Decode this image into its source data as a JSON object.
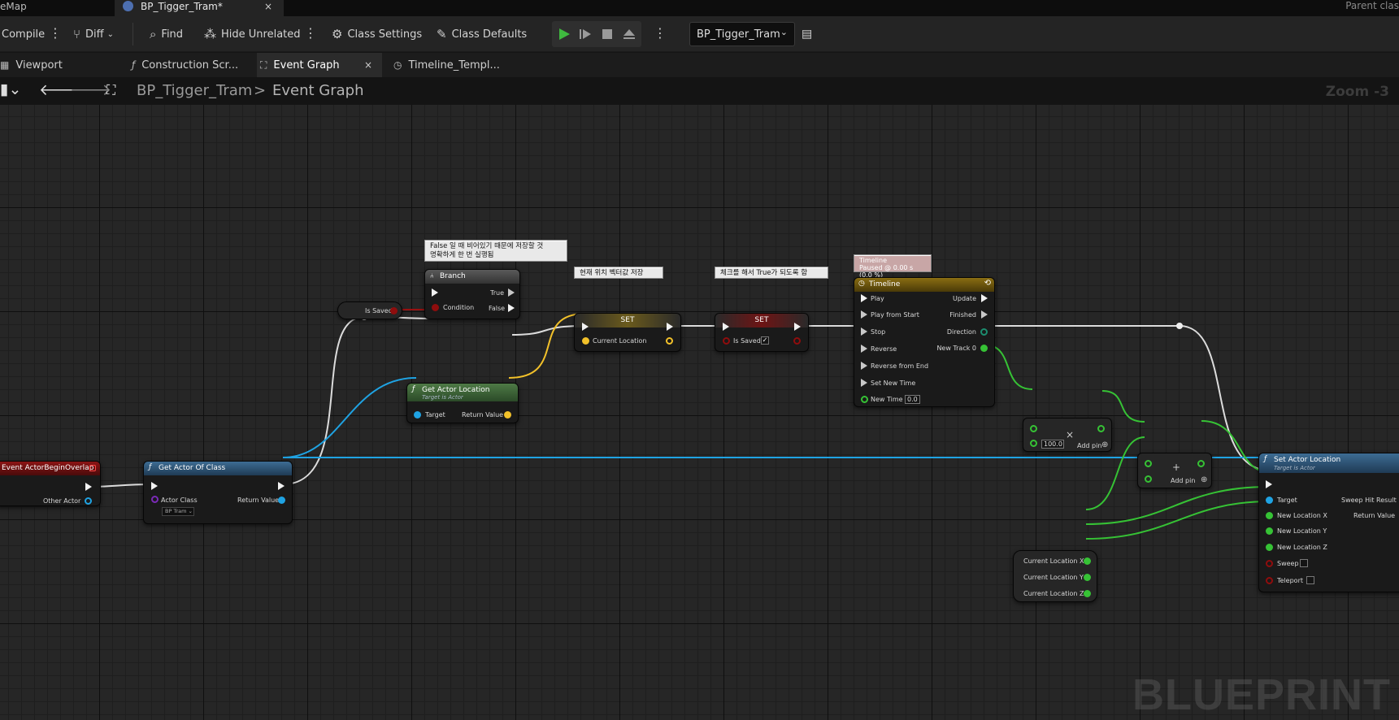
{
  "tabs": {
    "map_tab_label": "eMap",
    "blueprint_tab_label": "BP_Tigger_Tram*",
    "close_glyph": "×",
    "parent_class_label": "Parent clas"
  },
  "toolbar": {
    "compile_label": "Compile",
    "diff_label": "Diff",
    "find_label": "Find",
    "hide_unrelated_label": "Hide Unrelated",
    "class_settings_label": "Class Settings",
    "class_defaults_label": "Class Defaults",
    "debug_object": "BP_Tigger_Tram",
    "play_color": "#3fb93f"
  },
  "graph_tabs": {
    "viewport": "Viewport",
    "construction": "Construction Scr...",
    "event_graph": "Event Graph",
    "timeline": "Timeline_Templ..."
  },
  "breadcrumb": {
    "blueprint": "BP_Tigger_Tram",
    "separator": ">",
    "graph": "Event Graph",
    "zoom": "Zoom -3"
  },
  "comments": {
    "branch": [
      "False 일 때 비어있기 때문에 저장할 것",
      "명확하게 한 번 실행됨"
    ],
    "set_location": "현재 위치 벡터값 저장",
    "set_saved": "체크를 해서 True가 되도록 함",
    "timeline": [
      "Timeline",
      "Paused @ 0.00 s (0.0 %)"
    ]
  },
  "nodes": {
    "event": {
      "title": "Event ActorBeginOverlap",
      "pin_other_actor": "Other Actor"
    },
    "get_actor_of_class": {
      "title": "Get Actor Of Class",
      "pin_actor_class": "Actor Class",
      "actor_class_value": "BP Tram",
      "pin_return": "Return Value"
    },
    "is_saved_get": {
      "label": "Is Saved"
    },
    "branch": {
      "title": "Branch",
      "pin_true": "True",
      "pin_false": "False",
      "pin_condition": "Condition"
    },
    "get_actor_location": {
      "title": "Get Actor Location",
      "subtitle": "Target is Actor",
      "pin_target": "Target",
      "pin_return": "Return Value"
    },
    "set_location": {
      "title": "SET",
      "pin_current_location": "Current Location"
    },
    "set_saved": {
      "title": "SET",
      "pin_is_saved": "Is Saved",
      "checked_glyph": "✓"
    },
    "timeline": {
      "title": "Timeline",
      "inputs": [
        "Play",
        "Play from Start",
        "Stop",
        "Reverse",
        "Reverse from End",
        "Set New Time",
        "New Time"
      ],
      "outputs": [
        "Update",
        "Finished",
        "Direction",
        "New Track 0"
      ],
      "new_time_value": "0.0"
    },
    "multiply": {
      "value": "100.0",
      "add_pin": "Add pin",
      "operator": "×"
    },
    "add": {
      "add_pin": "Add pin",
      "operator": "+"
    },
    "current_location_vars": {
      "x": "Current Location X",
      "y": "Current Location Y",
      "z": "Current Location Z"
    },
    "set_actor_location": {
      "title": "Set Actor Location",
      "subtitle": "Target is Actor",
      "inputs": [
        "Target",
        "New Location X",
        "New Location Y",
        "New Location Z",
        "Sweep",
        "Teleport"
      ],
      "outputs": [
        "Sweep Hit Result",
        "Return Value"
      ]
    }
  },
  "watermark": "BLUEPRINT",
  "colors": {
    "exec": "#f0f0f0",
    "object_pin": "#1fa3e3",
    "bool_pin": "#8f0d0d",
    "vector_pin": "#f2c12a",
    "float_pin": "#36c235",
    "function_header": "#31597a",
    "event_header": "#7a1010",
    "pure_header": "#3d6b3a",
    "timeline_header": "#8a6d12"
  }
}
